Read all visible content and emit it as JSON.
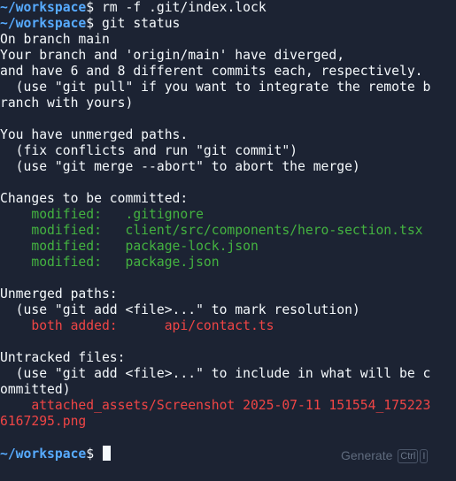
{
  "prompt": {
    "path": "~/workspace",
    "symbol": "$"
  },
  "lines": {
    "cmd1": "rm -f .git/index.lock",
    "cmd2": "git status",
    "l3": "On branch main",
    "l4": "Your branch and 'origin/main' have diverged,",
    "l5": "and have 6 and 8 different commits each, respectively.",
    "l6": "  (use \"git pull\" if you want to integrate the remote b",
    "l7": "ranch with yours)",
    "l9": "You have unmerged paths.",
    "l10": "  (fix conflicts and run \"git commit\")",
    "l11": "  (use \"git merge --abort\" to abort the merge)",
    "l13": "Changes to be committed:",
    "l14": "    modified:   .gitignore",
    "l15": "    modified:   client/src/components/hero-section.tsx",
    "l16": "    modified:   package-lock.json",
    "l17": "    modified:   package.json",
    "l19": "Unmerged paths:",
    "l20": "  (use \"git add <file>...\" to mark resolution)",
    "l21": "    both added:      api/contact.ts",
    "l23": "Untracked files:",
    "l24": "  (use \"git add <file>...\" to include in what will be c",
    "l25": "ommitted)",
    "l26": "    attached_assets/Screenshot 2025-07-11 151554_175223",
    "l27": "6167295.png"
  },
  "hint": {
    "label": "Generate",
    "key1": "Ctrl",
    "key2": "I"
  },
  "colors": {
    "background": "#1c2333",
    "prompt": "#57abff",
    "staged": "#44b340",
    "conflict": "#f04545",
    "text": "#f5f9fc"
  }
}
